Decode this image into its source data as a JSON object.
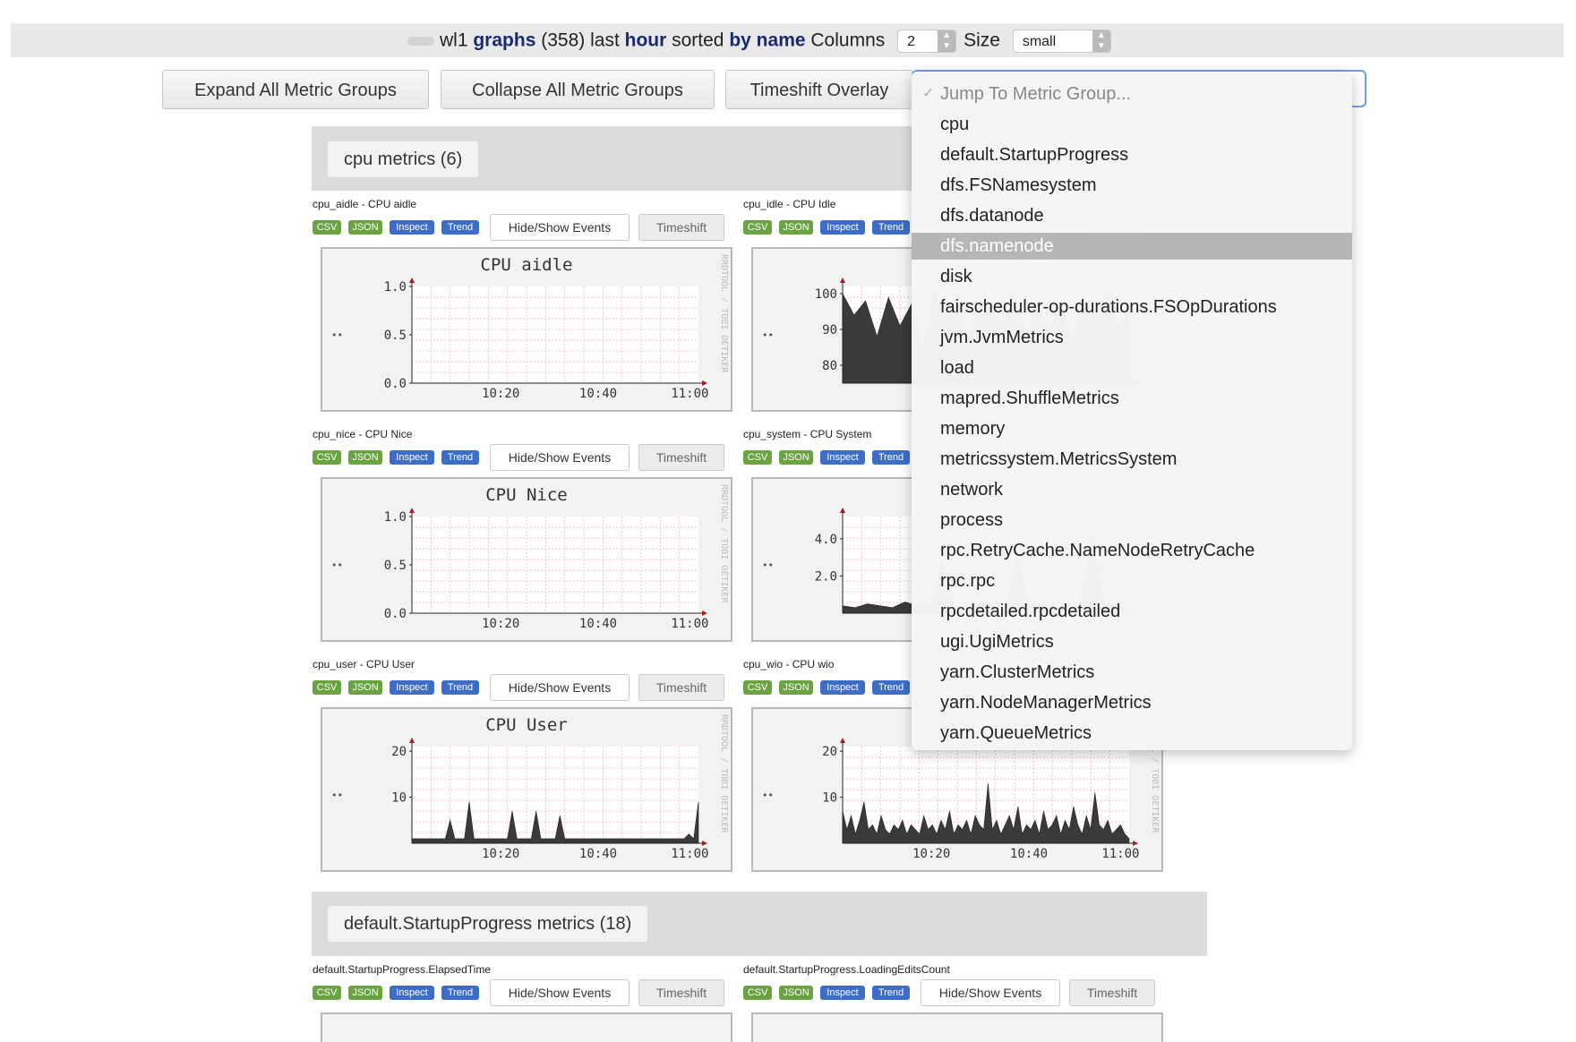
{
  "topbar": {
    "host": "wl1",
    "graphs_word": "graphs",
    "count": "(358)",
    "last_word": "last",
    "range": "hour",
    "sorted_word": "sorted",
    "by_name": "by name",
    "columns_label": "Columns",
    "columns_value": "2",
    "size_label": "Size",
    "size_value": "small"
  },
  "toolbar": {
    "expand_label": "Expand All Metric Groups",
    "collapse_label": "Collapse All Metric Groups",
    "timeshift_label": "Timeshift Overlay"
  },
  "dropdown": {
    "items": [
      "Jump To Metric Group...",
      "cpu",
      "default.StartupProgress",
      "dfs.FSNamesystem",
      "dfs.datanode",
      "dfs.namenode",
      "disk",
      "fairscheduler-op-durations.FSOpDurations",
      "jvm.JvmMetrics",
      "load",
      "mapred.ShuffleMetrics",
      "memory",
      "metricssystem.MetricsSystem",
      "network",
      "process",
      "rpc.RetryCache.NameNodeRetryCache",
      "rpc.rpc",
      "rpcdetailed.rpcdetailed",
      "ugi.UgiMetrics",
      "yarn.ClusterMetrics",
      "yarn.NodeManagerMetrics",
      "yarn.QueueMetrics"
    ],
    "selected": "dfs.namenode"
  },
  "groups": [
    {
      "label": "cpu metrics (6)"
    },
    {
      "label": "default.StartupProgress metrics (18)"
    }
  ],
  "metric_buttons": {
    "csv": "CSV",
    "json": "JSON",
    "inspect": "Inspect",
    "trend": "Trend",
    "hide_show": "Hide/Show Events",
    "timeshift": "Timeshift"
  },
  "metrics": [
    {
      "title": "cpu_aidle - CPU aidle",
      "chart_title": "CPU aidle"
    },
    {
      "title": "cpu_idle - CPU Idle",
      "chart_title": ""
    },
    {
      "title": "cpu_nice - CPU Nice",
      "chart_title": "CPU Nice"
    },
    {
      "title": "cpu_system - CPU System",
      "chart_title": "C"
    },
    {
      "title": "cpu_user - CPU User",
      "chart_title": "CPU User"
    },
    {
      "title": "cpu_wio - CPU wio",
      "chart_title": ""
    },
    {
      "title": "default.StartupProgress.ElapsedTime",
      "chart_title": ""
    },
    {
      "title": "default.StartupProgress.LoadingEditsCount",
      "chart_title": ""
    }
  ],
  "watermark": "RRDTOOL / TOBI OETIKER",
  "chart_data": [
    {
      "type": "line",
      "title": "CPU aidle",
      "x_ticks": [
        "10:20",
        "10:40",
        "11:00"
      ],
      "y_ticks": [
        "0.0",
        "0.5",
        "1.0"
      ],
      "ylim": [
        0,
        1.0
      ],
      "series": [
        {
          "values": []
        }
      ]
    },
    {
      "type": "area",
      "title": "",
      "x_ticks": [],
      "y_ticks": [
        "80",
        "90",
        "100"
      ],
      "ylim": [
        75,
        102
      ],
      "series": [
        {
          "values": [
            100,
            94,
            98,
            88,
            99,
            91,
            97,
            85,
            100,
            93,
            96,
            89,
            99,
            95,
            92,
            100,
            88,
            97,
            90,
            99,
            86,
            98,
            94,
            100,
            91,
            96
          ]
        }
      ]
    },
    {
      "type": "line",
      "title": "CPU Nice",
      "x_ticks": [
        "10:20",
        "10:40",
        "11:00"
      ],
      "y_ticks": [
        "0.0",
        "0.5",
        "1.0"
      ],
      "ylim": [
        0,
        1.0
      ],
      "series": [
        {
          "values": []
        }
      ]
    },
    {
      "type": "area",
      "title": "C",
      "x_ticks": [],
      "y_ticks": [
        "2.0",
        "4.0"
      ],
      "ylim": [
        0,
        5.2
      ],
      "series": [
        {
          "values": [
            0.4,
            0.3,
            0.5,
            0.4,
            0.3,
            0.6,
            0.4,
            0.3,
            2.8,
            0.4,
            0.3,
            0.5,
            0.4,
            0.3,
            3.2,
            0.4,
            0.5,
            0.3,
            0.4,
            0.3,
            4.1,
            0.5,
            0.4,
            0.3
          ]
        }
      ]
    },
    {
      "type": "area",
      "title": "CPU User",
      "x_ticks": [
        "10:20",
        "10:40",
        "11:00"
      ],
      "y_ticks": [
        "10",
        "20"
      ],
      "ylim": [
        0,
        21
      ],
      "series": [
        {
          "values": [
            1,
            1,
            1,
            1,
            1,
            1,
            1,
            1,
            5,
            1,
            1,
            1,
            9,
            1,
            1,
            1,
            1,
            1,
            1,
            1,
            1,
            7,
            1,
            1,
            1,
            1,
            7,
            1,
            1,
            1,
            1,
            6,
            1,
            1,
            1,
            1,
            1,
            1,
            1,
            1,
            1,
            1,
            1,
            1,
            1,
            1,
            1,
            1,
            1,
            1,
            1,
            1,
            1,
            1,
            1,
            1,
            1,
            1,
            2,
            1,
            9
          ]
        }
      ]
    },
    {
      "type": "area",
      "title": "",
      "x_ticks": [
        "10:20",
        "10:40",
        "11:00"
      ],
      "y_ticks": [
        "10",
        "20"
      ],
      "ylim": [
        0,
        21
      ],
      "series": [
        {
          "values": [
            7,
            3,
            6,
            2,
            5,
            9,
            3,
            4,
            2,
            6,
            3,
            2,
            4,
            3,
            5,
            2,
            4,
            3,
            2,
            6,
            3,
            4,
            2,
            5,
            3,
            7,
            2,
            4,
            3,
            5,
            2,
            6,
            4,
            3,
            13,
            3,
            5,
            2,
            4,
            6,
            3,
            8,
            2,
            4,
            3,
            5,
            2,
            7,
            3,
            4,
            6,
            2,
            5,
            3,
            8,
            4,
            2,
            6,
            3,
            11,
            4,
            3,
            5,
            2,
            3,
            4,
            2,
            1
          ]
        }
      ]
    }
  ]
}
